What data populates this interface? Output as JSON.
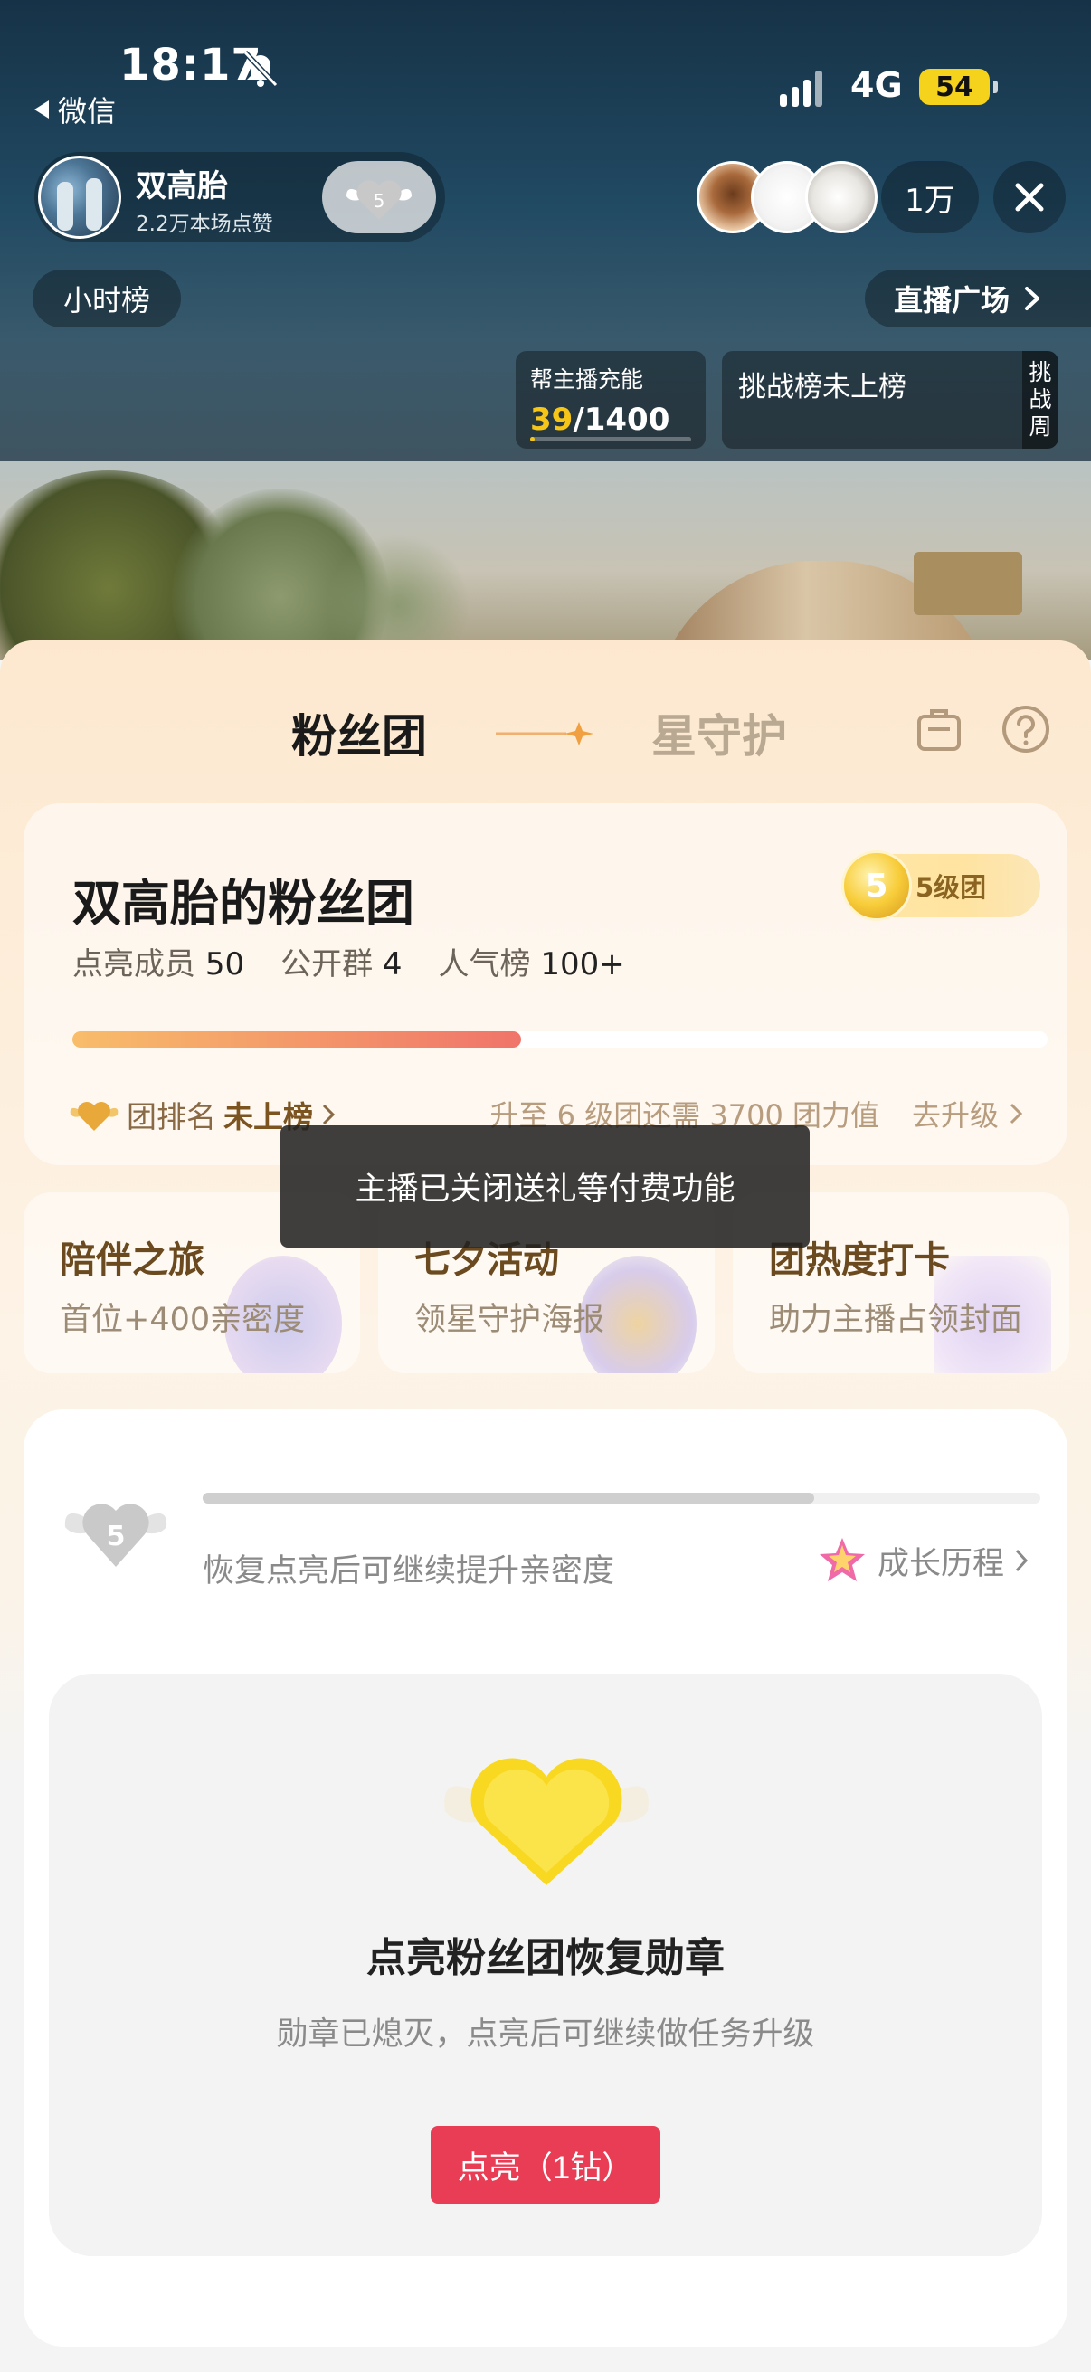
{
  "status_bar": {
    "time": "18:17",
    "back_app": "微信",
    "network": "4G",
    "battery": "54"
  },
  "host": {
    "name": "双高胎",
    "likes": "2.2万本场点赞",
    "fan_level": "5"
  },
  "viewers": {
    "count": "1万"
  },
  "buttons": {
    "hour_rank": "小时榜",
    "live_plaza": "直播广场"
  },
  "charge": {
    "title": "帮主播充能",
    "current": "39",
    "total": "/1400",
    "progress": 0.028
  },
  "challenge": {
    "label": "挑战榜未上榜",
    "tag": "挑战周"
  },
  "tabs": [
    {
      "label": "粉丝团",
      "active": true
    },
    {
      "label": "星守护",
      "active": false
    }
  ],
  "club": {
    "title": "双高胎的粉丝团",
    "level_number": "5",
    "level_label": "5级团",
    "stats": [
      {
        "label": "点亮成员",
        "value": "50"
      },
      {
        "label": "公开群",
        "value": "4"
      },
      {
        "label": "人气榜",
        "value": "100+"
      }
    ],
    "progress": 0.46,
    "rank_label": "团排名",
    "rank_value": "未上榜",
    "upgrade_hint": "升至 6 级团还需 3700 团力值",
    "upgrade_action": "去升级"
  },
  "toast": "主播已关闭送礼等付费功能",
  "activities": [
    {
      "title": "陪伴之旅",
      "sub": "首位+400亲密度"
    },
    {
      "title": "七夕活动",
      "sub": "领星守护海报"
    },
    {
      "title": "团热度打卡",
      "sub": "助力主播占领封面"
    }
  ],
  "badge": {
    "level": "5",
    "progress": 0.73,
    "hint": "恢复点亮后可继续提升亲密度",
    "history": "成长历程",
    "relight_title": "点亮粉丝团恢复勋章",
    "relight_desc": "勋章已熄灭，点亮后可继续做任务升级",
    "relight_button": "点亮（1钻）"
  },
  "colors": {
    "accent_red": "#e83d55",
    "gold": "#f5c518",
    "progress_start": "#f8bd6a",
    "progress_end": "#f0746a"
  }
}
